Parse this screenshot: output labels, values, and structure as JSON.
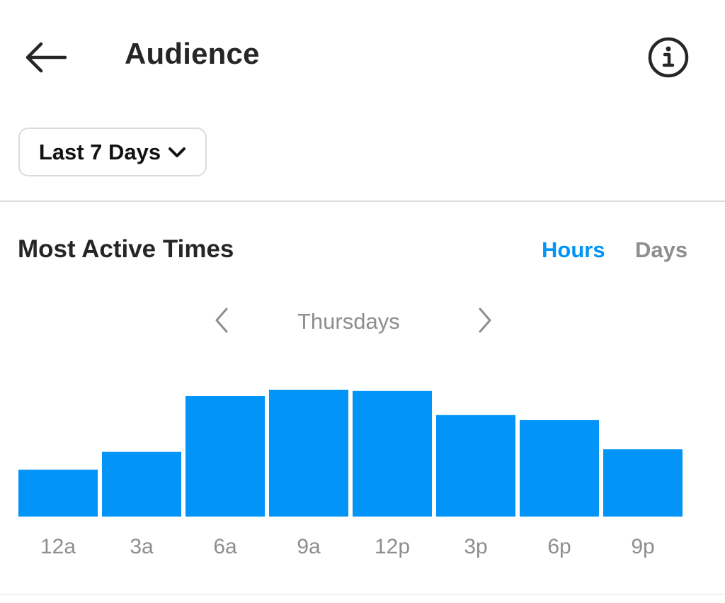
{
  "header": {
    "title": "Audience",
    "back_icon": "arrow-left-icon",
    "info_icon": "info-circle-icon"
  },
  "filter": {
    "range_label": "Last 7 Days",
    "range_icon": "chevron-down-icon"
  },
  "section": {
    "title": "Most Active Times",
    "toggle": [
      {
        "label": "Hours",
        "active": true
      },
      {
        "label": "Days",
        "active": false
      }
    ],
    "day_nav": {
      "prev_icon": "chevron-left-icon",
      "label": "Thursdays",
      "next_icon": "chevron-right-icon"
    }
  },
  "colors": {
    "accent": "#0095f6",
    "bar": "#0294f7",
    "muted": "#8e8e8e",
    "text": "#262626"
  },
  "chart_data": {
    "type": "bar",
    "title": "Most Active Times",
    "subtitle": "Thursdays",
    "xlabel": "",
    "ylabel": "",
    "categories": [
      "12a",
      "3a",
      "6a",
      "9a",
      "12p",
      "3p",
      "6p",
      "9p"
    ],
    "values": [
      37,
      51,
      95,
      100,
      99,
      80,
      76,
      53
    ],
    "ylim": [
      0,
      100
    ],
    "grid": false,
    "legend": "none",
    "note": "values are relative activity (percent of peak), no y-axis shown"
  }
}
